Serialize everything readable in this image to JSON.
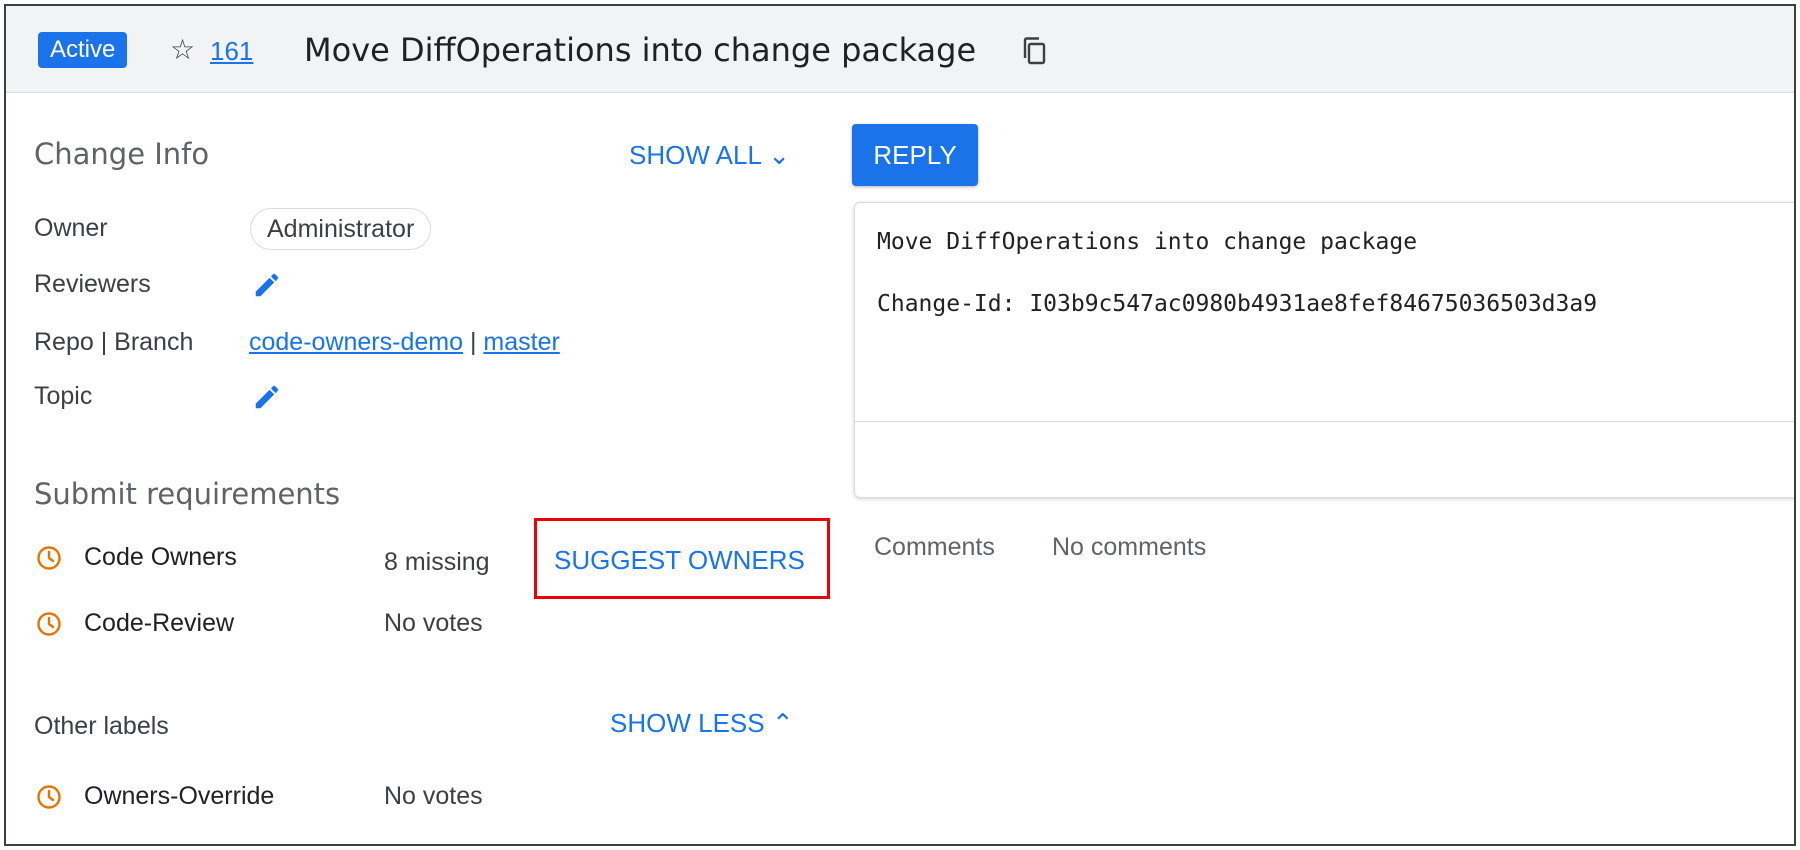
{
  "header": {
    "status_badge": "Active",
    "star_glyph": "☆",
    "star_count": "161",
    "title": "Move DiffOperations into change package",
    "icons": {
      "star": "star-outline-icon",
      "copy": "copy-icon"
    }
  },
  "change_info": {
    "title": "Change Info",
    "show_all_label": "SHOW ALL ⌄",
    "owner_label": "Owner",
    "owner_value": "Administrator",
    "reviewers_label": "Reviewers",
    "repo_branch_label": "Repo | Branch",
    "repo": "code-owners-demo",
    "separator": " | ",
    "branch": "master",
    "topic_label": "Topic",
    "icons": {
      "edit": "pencil-edit-icon"
    }
  },
  "submit_requirements": {
    "title": "Submit requirements",
    "rows": [
      {
        "name": "Code Owners",
        "status": "8 missing",
        "action": "SUGGEST OWNERS"
      },
      {
        "name": "Code-Review",
        "status": "No votes"
      }
    ],
    "icons": {
      "pending": "clock-icon"
    }
  },
  "other_labels": {
    "title": "Other labels",
    "show_less_label": "SHOW LESS ⌃",
    "rows": [
      {
        "name": "Owners-Override",
        "status": "No votes"
      }
    ]
  },
  "reply": {
    "label": "REPLY"
  },
  "commit_message": {
    "line1": "Move DiffOperations into change package",
    "line2": "Change-Id: I03b9c547ac0980b4931ae8fef84675036503d3a9"
  },
  "comments": {
    "label": "Comments",
    "value": "No comments"
  },
  "colors": {
    "accent": "#1a73e8",
    "pending_clock": "#e37400",
    "highlight_box": "#e8000b"
  }
}
